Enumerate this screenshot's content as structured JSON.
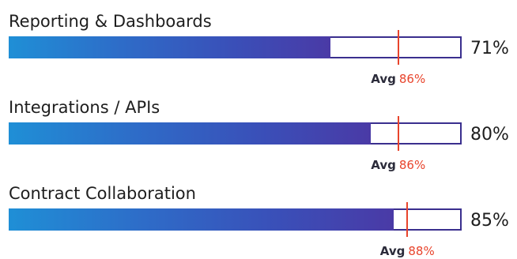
{
  "chart_data": {
    "type": "bar",
    "orientation": "horizontal",
    "categories": [
      "Reporting & Dashboards",
      "Integrations / APIs",
      "Contract Collaboration"
    ],
    "values": [
      71,
      80,
      85
    ],
    "value_labels": [
      "71%",
      "80%",
      "85%"
    ],
    "averages": [
      86,
      86,
      88
    ],
    "average_labels": [
      "86%",
      "86%",
      "88%"
    ],
    "avg_word": "Avg",
    "xlim": [
      0,
      100
    ],
    "grid": false,
    "colors": {
      "bar_start": "#1f8fd6",
      "bar_end": "#4a3aa6",
      "track_border": "#3a2f8e",
      "avg_marker": "#e8442c"
    }
  }
}
